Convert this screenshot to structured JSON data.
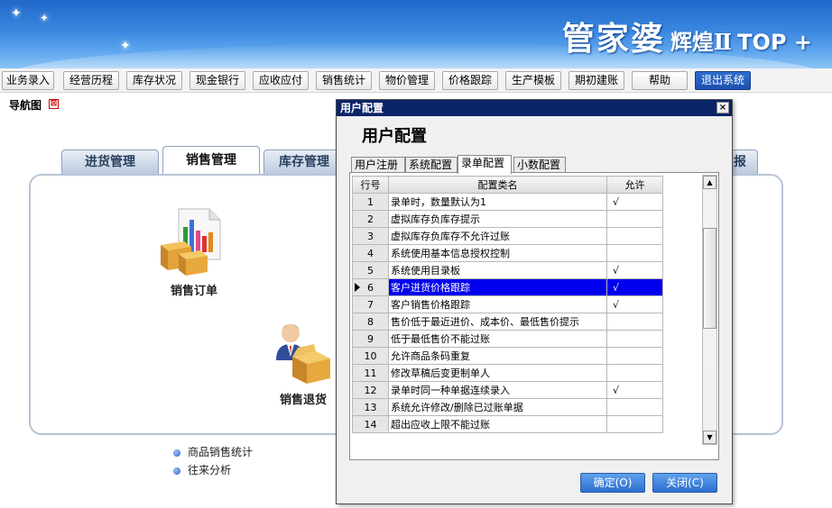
{
  "header": {
    "brand_main": "管家婆",
    "brand_sub": "辉煌Ⅱ",
    "brand_top": "TOP +"
  },
  "toolbar": {
    "items": [
      "业务录入",
      "经营历程",
      "库存状况",
      "现金银行",
      "应收应付",
      "销售统计",
      "物价管理",
      "价格跟踪",
      "生产模板",
      "期初建账",
      "帮助",
      "退出系统"
    ]
  },
  "nav": {
    "tab_label": "导航图",
    "close_glyph": "⊠"
  },
  "modules": {
    "tabs": [
      "进货管理",
      "销售管理",
      "库存管理",
      "报"
    ],
    "icons": {
      "sales_order": "销售订单",
      "sales_return": "销售退货"
    },
    "links": [
      "商品销售统计",
      "往来分析"
    ]
  },
  "dialog": {
    "title": "用户配置",
    "heading": "用户配置",
    "close_glyph": "×",
    "tabs": [
      "用户注册",
      "系统配置",
      "录单配置",
      "小数配置"
    ],
    "grid": {
      "columns": [
        "行号",
        "配置类名",
        "允许"
      ],
      "rows": [
        {
          "no": "1",
          "name": "录单时，数量默认为1",
          "allow": "√"
        },
        {
          "no": "2",
          "name": "虚拟库存负库存提示",
          "allow": ""
        },
        {
          "no": "3",
          "name": "虚拟库存负库存不允许过账",
          "allow": ""
        },
        {
          "no": "4",
          "name": "系统使用基本信息授权控制",
          "allow": ""
        },
        {
          "no": "5",
          "name": "系统使用目录板",
          "allow": "√"
        },
        {
          "no": "6",
          "name": "客户进货价格跟踪",
          "allow": "√"
        },
        {
          "no": "7",
          "name": "客户销售价格跟踪",
          "allow": "√"
        },
        {
          "no": "8",
          "name": "售价低于最近进价、成本价、最低售价提示",
          "allow": ""
        },
        {
          "no": "9",
          "name": "低于最低售价不能过账",
          "allow": ""
        },
        {
          "no": "10",
          "name": "允许商品条码重复",
          "allow": ""
        },
        {
          "no": "11",
          "name": "修改草稿后变更制单人",
          "allow": ""
        },
        {
          "no": "12",
          "name": "录单时同一种单据连续录入",
          "allow": "√"
        },
        {
          "no": "13",
          "name": "系统允许修改/删除已过账单据",
          "allow": ""
        },
        {
          "no": "14",
          "name": "超出应收上限不能过账",
          "allow": ""
        }
      ]
    },
    "ok_label": "确定(O)",
    "close_label": "关闭(C)"
  }
}
